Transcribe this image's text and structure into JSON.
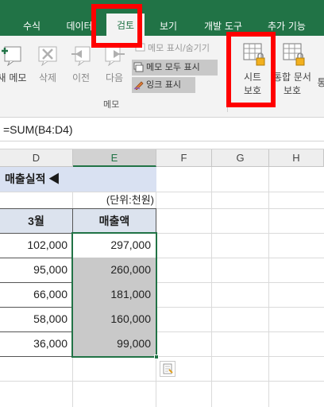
{
  "ribbon_tabs": [
    {
      "label": "수식",
      "active": false
    },
    {
      "label": "데이터",
      "active": false
    },
    {
      "label": "검토",
      "active": true
    },
    {
      "label": "보기",
      "active": false
    },
    {
      "label": "개발 도구",
      "active": false
    },
    {
      "label": "추가 기능",
      "active": false
    }
  ],
  "ribbon": {
    "new_memo": "새 메모",
    "delete": "삭제",
    "previous": "이전",
    "next": "다음",
    "show_hide_memo": "메모 표시/숨기기",
    "show_all_memos": "메모 모두 표시",
    "show_ink": "잉크 표시",
    "memo_group_label": "메모",
    "protect_sheet_line1": "시트",
    "protect_sheet_line2": "보호",
    "protect_workbook_line1": "통합 문서",
    "protect_workbook_line2": "보호",
    "cut_off_label": "통"
  },
  "formula_bar": {
    "formula": "=SUM(B4:D4)"
  },
  "column_headers": [
    "D",
    "E",
    "F",
    "G",
    "H"
  ],
  "sheet": {
    "title": "매출실적 ◀",
    "unit_note": "(단위:천원)",
    "table": {
      "headers": [
        "3월",
        "매출액"
      ],
      "rows": [
        [
          "102,000",
          "297,000"
        ],
        [
          "95,000",
          "260,000"
        ],
        [
          "66,000",
          "181,000"
        ],
        [
          "58,000",
          "160,000"
        ],
        [
          "36,000",
          "99,000"
        ]
      ]
    }
  },
  "colors": {
    "ribbon_green": "#217346",
    "highlight_red": "#ff0000",
    "title_band": "#d9e1f2",
    "table_header": "#dce3ee",
    "selected_fill": "#c9c9c9"
  }
}
